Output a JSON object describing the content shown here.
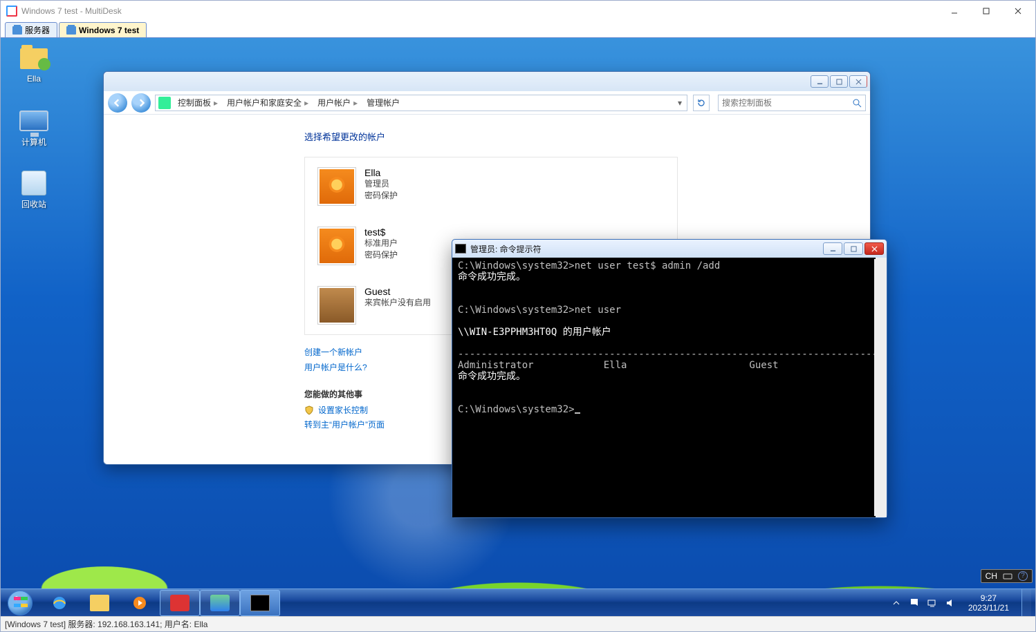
{
  "outer": {
    "title": "Windows 7 test - MultiDesk"
  },
  "md_tabs": {
    "servers": "服务器",
    "session": "Windows 7 test"
  },
  "desktop_icons": {
    "user_folder": "Ella",
    "computer": "计算机",
    "recycle_bin": "回收站"
  },
  "cp": {
    "crumbs": {
      "root": "控制面板",
      "family": "用户帐户和家庭安全",
      "accounts": "用户帐户",
      "manage": "管理帐户"
    },
    "search_placeholder": "搜索控制面板",
    "heading": "选择希望更改的帐户",
    "accounts": [
      {
        "name": "Ella",
        "role": "管理员",
        "pw": "密码保护"
      },
      {
        "name": "test$",
        "role": "标准用户",
        "pw": "密码保护"
      },
      {
        "name": "Guest",
        "role": "来宾帐户没有启用",
        "pw": ""
      }
    ],
    "links": {
      "create": "创建一个新帐户",
      "what": "用户帐户是什么?"
    },
    "other_heading": "您能做的其他事",
    "other": {
      "parental": "设置家长控制",
      "goto": "转到主“用户帐户”页面"
    }
  },
  "cmd": {
    "title": "管理员: 命令提示符",
    "l1": "C:\\Windows\\system32>net user test$ admin /add",
    "l2": "命令成功完成。",
    "l3": "",
    "l4": "",
    "l5": "C:\\Windows\\system32>net user",
    "l6": "",
    "l7": "\\\\WIN-E3PPHM3HT0Q 的用户帐户",
    "l8": "",
    "l9": "-------------------------------------------------------------------------------",
    "l10": "Administrator            Ella                     Guest",
    "l11": "命令成功完成。",
    "l12": "",
    "l13": "",
    "l14": "C:\\Windows\\system32>"
  },
  "lang": "CH",
  "clock": {
    "time": "9:27",
    "date": "2023/11/21"
  },
  "status": "[Windows 7 test] 服务器: 192.168.163.141; 用户名: Ella"
}
